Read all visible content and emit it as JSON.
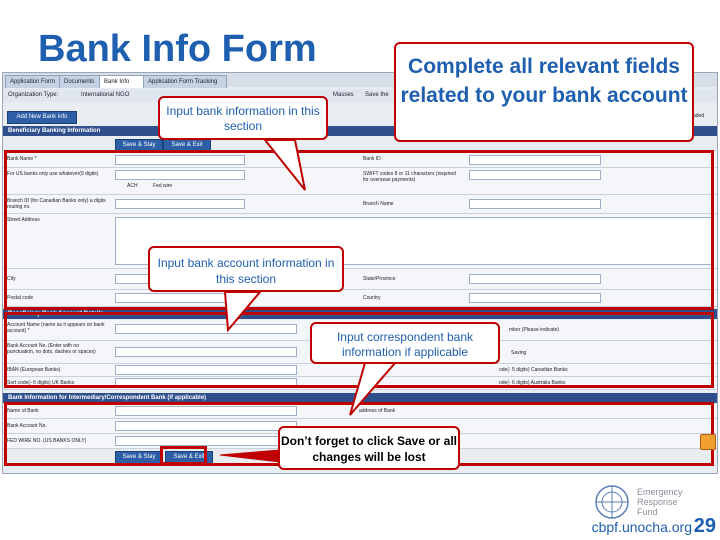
{
  "slide": {
    "title": "Bank Info Form",
    "footer_url": "cbpf.unocha.org",
    "page_number": "29"
  },
  "screen": {
    "tabs": [
      "Application Form",
      "Documents",
      "Bank Info",
      "Application Form Tracking"
    ],
    "org_label": "Organization Type:",
    "org_value": "International NGO",
    "org_right_1": "Masses",
    "org_right_2": "Save the",
    "add_bank_button": "Add New Bank info",
    "sections": {
      "beneficiary_banking": "Beneficiary Banking Information",
      "beneficiary_account": "Beneficiary Bank Account Details",
      "intermediary": "Bank Information for Intermediary/Correspondent Bank (if applicable)"
    },
    "save_stay": "Save & Stay",
    "save_exit": "Save & Exit",
    "fields": {
      "bank_name": "Bank Name *",
      "us_banks": "For US banks only use whatever(9 digits)",
      "ach": "ACH",
      "fed_wire": "Fed wire",
      "branch_id": "Branch ID (for Canadian Banks only) a digits routing no.",
      "street_address": "Street Address",
      "city": "City",
      "postal_code": "Postal code",
      "bank_id": "Bank ID",
      "swift": "SWIFT codes 8 or 11 characters (required for overseas payments)",
      "branch_name": "Branch Name",
      "state": "State/Province",
      "country": "Country",
      "account_name": "Account Name (name as it appears on bank account) *",
      "account_no": "Bank Account No. (Enter with no punctuation, no dots, dashes or spaces)",
      "iban": "IBAN (European Banks)",
      "sort_code": "Sort code(- 6 digits) UK Banks",
      "number_indicate": "mber (Please indicate)",
      "saving": "Saving",
      "canadian_banks": "ode(- 5 digits) Canadian Banks",
      "australia": "ode(- 6 digits) Australia Banks",
      "inter_bank_name": "Name of Bank",
      "inter_account_no": "Bank Account No.",
      "fed_wire_no": "FED WIRE NO. (US BANKS ONLY)",
      "address_bank": "address of Bank",
      "loaded": "aded"
    }
  },
  "callouts": {
    "complete_all": "Complete all relevant fields related to your bank account",
    "input_bank_info": "Input bank information in this section",
    "input_account_info": "Input bank account information in this section",
    "input_correspondent": "Input correspondent bank information if applicable",
    "dont_forget": "Don’t forget to click Save or all changes will be lost"
  },
  "logo": {
    "line1": "Emergency",
    "line2": "Response",
    "line3": "Fund"
  },
  "colors": {
    "title_blue": "#1f5fb0",
    "highlight_red": "#c00000",
    "section_header": "#2f4f8c"
  }
}
